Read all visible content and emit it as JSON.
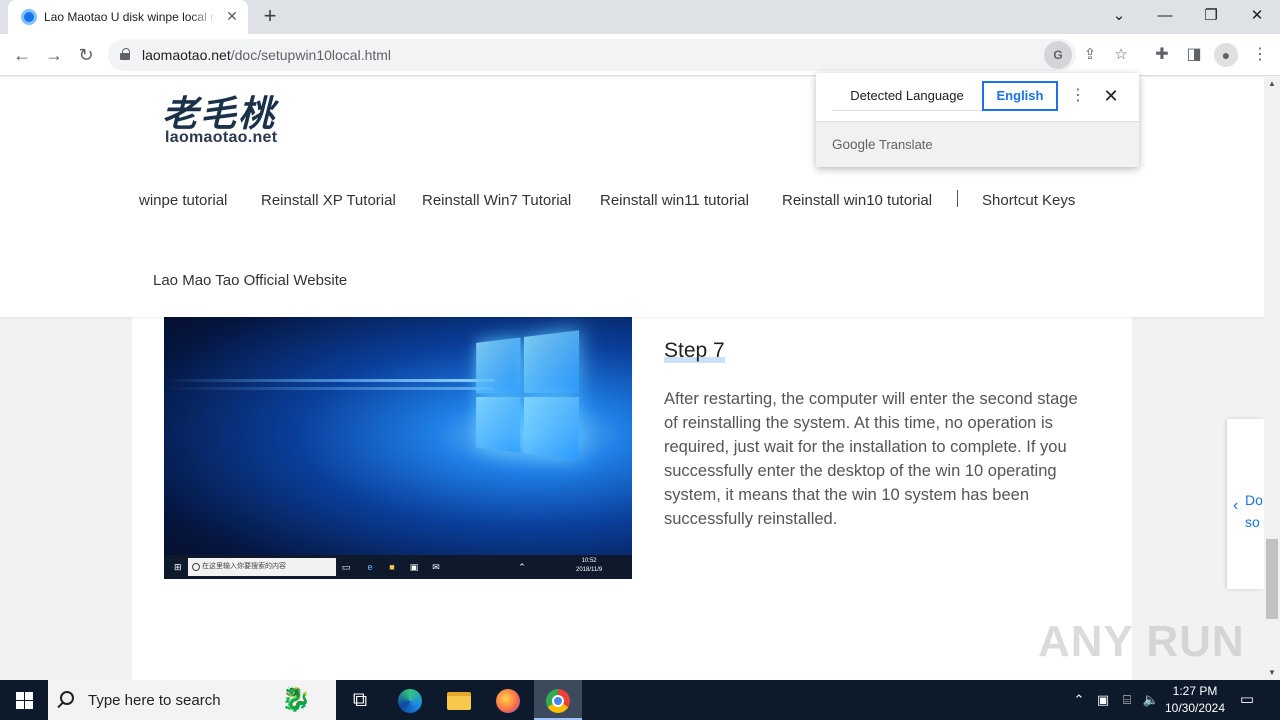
{
  "browser": {
    "tab_title": "Lao Maotao U disk winpe local reinstall",
    "tab_close": "✕",
    "new_tab": "+",
    "url_domain": "laomaotao.net",
    "url_path": "/doc/setupwin10local.html",
    "window_controls": {
      "tabsearch": "⌄",
      "minimize": "—",
      "restore": "❐",
      "close": "✕"
    },
    "nav": {
      "back": "←",
      "forward": "→",
      "reload": "↻"
    }
  },
  "translate_popup": {
    "detected_language": "Detected Language",
    "target_language": "English",
    "menu": "⋮",
    "close": "✕",
    "brand_google": "Google",
    "brand_translate": "Translate"
  },
  "site": {
    "logo_cn": "老毛桃",
    "logo_en": "laomaotao.net",
    "nav_items": [
      "winpe tutorial",
      "Reinstall XP Tutorial",
      "Reinstall Win7 Tutorial",
      "Reinstall win11 tutorial",
      "Reinstall win10 tutorial",
      "Shortcut Keys",
      "Lao Mao Tao Official Website"
    ]
  },
  "content": {
    "screenshot_search": "在这里输入你要搜索的内容",
    "screenshot_time": "10:52",
    "screenshot_date": "2018/11/9",
    "step_title": "Step 7",
    "step_text": "After restarting, the computer will enter the second stage of reinstalling the system. At this time, no operation is required, just wait for the installation to complete. If you successfully enter the desktop of the win 10 operating system, it means that the win 10 system has been successfully reinstalled."
  },
  "side_float": {
    "chevron": "‹",
    "line1": "Do",
    "line2": "so"
  },
  "watermark": "ANY RUN",
  "taskbar": {
    "search_placeholder": "Type here to search",
    "time": "1:27 PM",
    "date": "10/30/2024"
  },
  "colors": {
    "link_blue": "#1a73e8",
    "taskbar_bg": "#0d1a2b",
    "nav_text": "#333333"
  }
}
